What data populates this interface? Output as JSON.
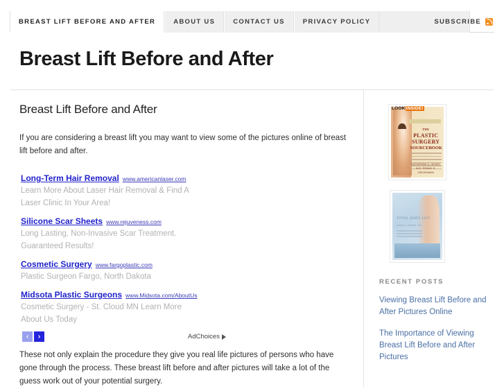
{
  "nav": {
    "tabs": [
      {
        "label": "BREAST LIFT BEFORE AND AFTER",
        "active": true
      },
      {
        "label": "ABOUT US",
        "active": false
      },
      {
        "label": "CONTACT US",
        "active": false
      },
      {
        "label": "PRIVACY POLICY",
        "active": false
      }
    ],
    "subscribe_label": "SUBSCRIBE",
    "rss_icon": "rss-icon",
    "rss_color": "#f19024"
  },
  "site": {
    "title": "Breast Lift Before and After"
  },
  "post": {
    "title": "Breast Lift Before and After",
    "intro": "If you are considering a breast lift you may want to view some of the pictures online of breast lift before and after.",
    "outro": "These not only explain the procedure they give you real life pictures of persons who have gone through the process. These breast lift before and after pictures will take a lot of the guess work out of your potential surgery."
  },
  "ads": {
    "items": [
      {
        "headline": "Long-Term Hair Removal",
        "url": "www.americanlaser.com",
        "lines": [
          "Learn More About Laser Hair Removal & Find A",
          "Laser Clinic In Your Area!"
        ]
      },
      {
        "headline": "Silicone Scar Sheets",
        "url": "www.rejuveness.com",
        "lines": [
          "Long Lasting, Non-Invasive Scar Treatment.",
          "Guaranteed Results!"
        ]
      },
      {
        "headline": "Cosmetic Surgery",
        "url": "www.fargoplastic.com",
        "lines": [
          "Plastic Surgeon Fargo, North Dakota"
        ]
      },
      {
        "headline": "Midsota Plastic Surgeons",
        "url": "www.Midsota.com/AboutUs",
        "lines": [
          "Cosmetic Surgery - St. Cloud MN Learn More",
          "About Us Today"
        ]
      }
    ],
    "prev_label": "‹",
    "next_label": "›",
    "adchoices_label": "AdChoices",
    "link_color": "#2222cc",
    "description_color": "#b2b2b2"
  },
  "sidebar": {
    "book1": {
      "badge_a": "LOOK",
      "badge_b": "INSIDE!",
      "line0": "THE",
      "line1": "PLASTIC",
      "line2": "SURGERY",
      "line3": "SOURCEBOOK",
      "authors": "KATHERINE A. HENRY  M.D.\nPENNY S. GROSSMAN"
    },
    "book2": {
      "title": "TOTAL BODY LIFT",
      "subtitle": "Dennis J. Hurwitz, M.D."
    },
    "widget_title": "Recent Posts",
    "recent_posts": [
      "Viewing Breast Lift Before and After Pictures Online",
      "The Importance of Viewing Breast Lift Before and After Pictures"
    ],
    "link_color": "#4a6fa5"
  }
}
